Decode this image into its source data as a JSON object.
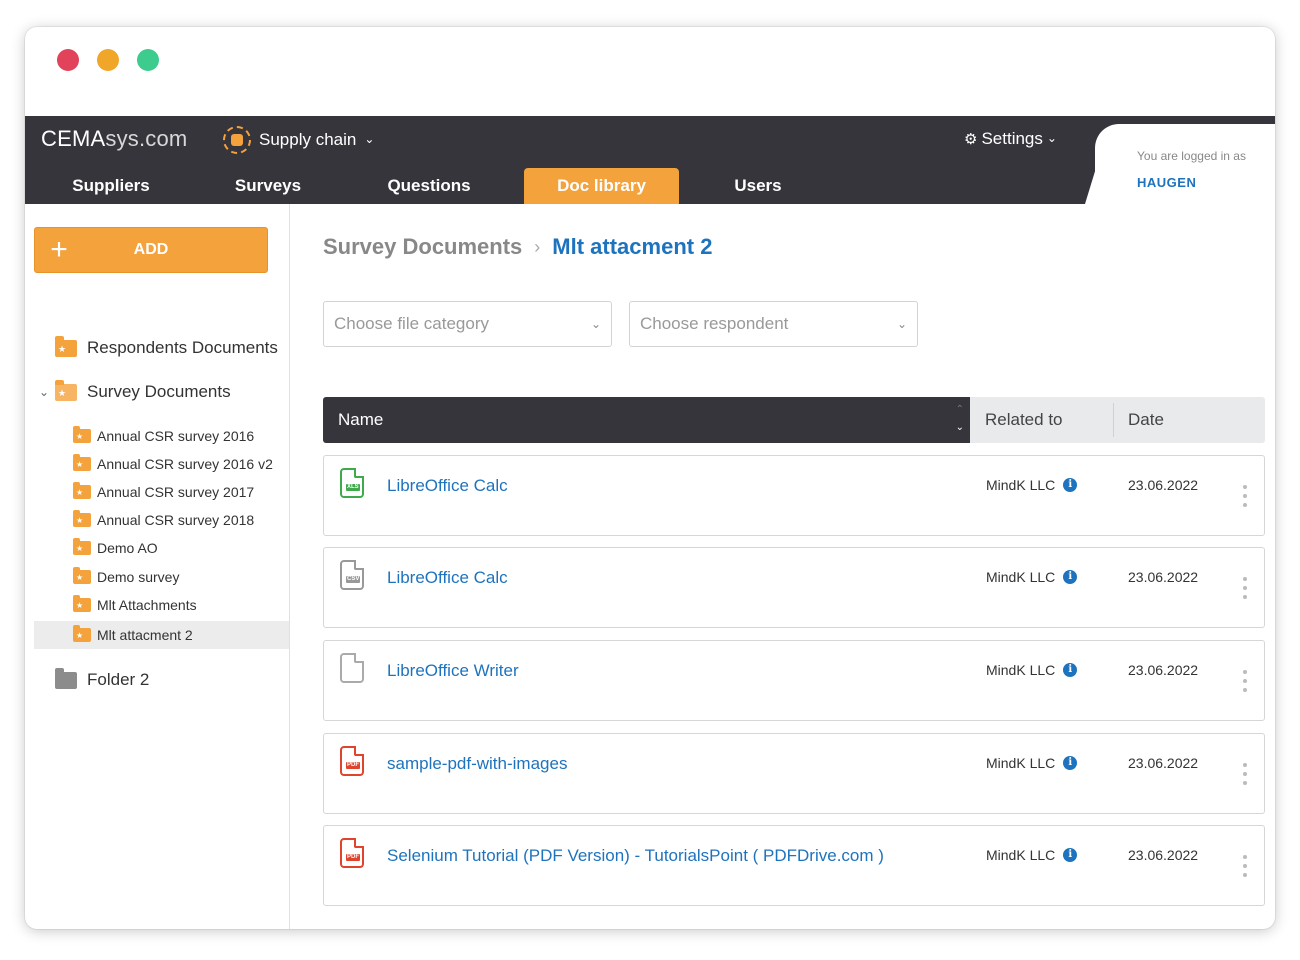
{
  "window": {
    "controls": {
      "close_color": "#e0435a",
      "minimize_color": "#f0a629",
      "maximize_color": "#3ecc8e"
    }
  },
  "header": {
    "logo_bold": "CEMA",
    "logo_light": "sys.com",
    "module": "Supply chain",
    "settings": "Settings",
    "nav": [
      "Suppliers",
      "Surveys",
      "Questions",
      "Doc library",
      "Users"
    ],
    "active_nav": "Doc library",
    "logged_in_label": "You are logged in as",
    "username": "HAUGEN",
    "colors": {
      "bar": "#36353b",
      "accent": "#f4a23c",
      "link": "#1e73be"
    }
  },
  "sidebar": {
    "add_label": "ADD",
    "roots": {
      "respondents": "Respondents Documents",
      "survey_docs": "Survey Documents",
      "folder2": "Folder 2"
    },
    "children": [
      "Annual CSR survey 2016",
      "Annual CSR survey 2016 v2",
      "Annual CSR survey 2017",
      "Annual CSR survey 2018",
      "Demo AO",
      "Demo survey",
      "Mlt Attachments",
      "Mlt attacment 2"
    ],
    "selected_child": "Mlt attacment 2"
  },
  "main": {
    "breadcrumb": {
      "parent": "Survey Documents",
      "current": "Mlt attacment 2"
    },
    "filters": {
      "category_placeholder": "Choose file category",
      "respondent_placeholder": "Choose respondent"
    },
    "table": {
      "headers": {
        "name": "Name",
        "related": "Related to",
        "date": "Date"
      },
      "rows": [
        {
          "name": "LibreOffice Calc",
          "icon": "spreadsheet-icon",
          "related": "MindK LLC",
          "date": "23.06.2022"
        },
        {
          "name": "LibreOffice Calc",
          "icon": "spreadsheet-grey-icon",
          "related": "MindK LLC",
          "date": "23.06.2022"
        },
        {
          "name": "LibreOffice Writer",
          "icon": "blank-file-icon",
          "related": "MindK LLC",
          "date": "23.06.2022"
        },
        {
          "name": "sample-pdf-with-images",
          "icon": "pdf-file-icon",
          "related": "MindK LLC",
          "date": "23.06.2022"
        },
        {
          "name": "Selenium Tutorial (PDF Version) - TutorialsPoint ( PDFDrive.com )",
          "icon": "pdf-file-icon",
          "related": "MindK LLC",
          "date": "23.06.2022"
        }
      ]
    }
  }
}
